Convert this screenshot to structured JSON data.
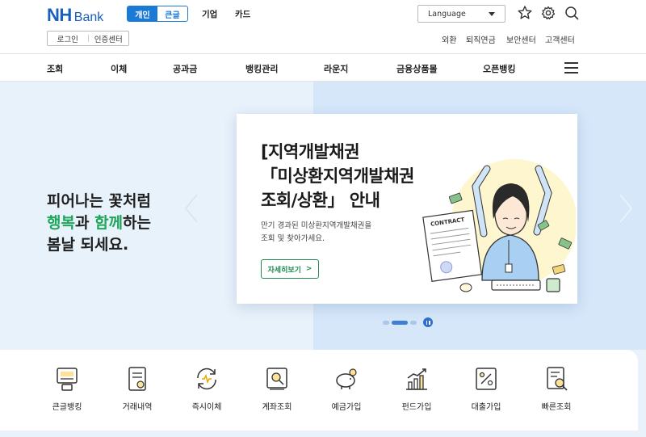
{
  "header": {
    "logo_nh": "NH",
    "logo_bank": "Bank",
    "segment": {
      "personal": "개인",
      "simple": "큰글"
    },
    "business": "기업",
    "card": "카드",
    "language": "Language",
    "login": "로그인",
    "cert_center": "인증센터",
    "utils": [
      "외환",
      "퇴직연금",
      "보안센터",
      "고객센터"
    ]
  },
  "gnb": {
    "items": [
      "조회",
      "이체",
      "공과금",
      "뱅킹관리",
      "라운지",
      "금융상품몰",
      "오픈뱅킹"
    ]
  },
  "hero": {
    "slogan_line1": "피어나는 꽃처럼",
    "slogan_green1": "행복",
    "slogan_mid": "과 ",
    "slogan_green2": "함께",
    "slogan_end": "하는",
    "slogan_line3": "봄날 되세요.",
    "card": {
      "title_line1": "[지역개발채권",
      "title_line2": "「미상환지역개발채권",
      "title_line3": "조회/상환」 안내",
      "desc_line1": "만기 경과된 미상환지역개발채권을",
      "desc_line2": "조회 및 찾아가세요.",
      "button": "자세히보기",
      "button_arrow": ">",
      "contract_label": "CONTRACT"
    },
    "slides": {
      "count": 3,
      "active_index": 1
    }
  },
  "quick": {
    "items": [
      {
        "label": "큰글뱅킹",
        "icon": "large-text-banking-icon"
      },
      {
        "label": "거래내역",
        "icon": "transaction-history-icon"
      },
      {
        "label": "즉시이체",
        "icon": "instant-transfer-icon"
      },
      {
        "label": "계좌조회",
        "icon": "account-inquiry-icon"
      },
      {
        "label": "예금가입",
        "icon": "piggy-bank-icon"
      },
      {
        "label": "펀드가입",
        "icon": "fund-chart-icon"
      },
      {
        "label": "대출가입",
        "icon": "loan-percent-icon"
      },
      {
        "label": "빠른조회",
        "icon": "quick-inquiry-icon"
      }
    ]
  },
  "colors": {
    "brand_blue": "#1a5fb8",
    "segment_blue": "#1a7ad6",
    "green": "#20a55a",
    "hero_bg_left": "#e8f2fb",
    "hero_bg_right": "#d6e7fa"
  }
}
